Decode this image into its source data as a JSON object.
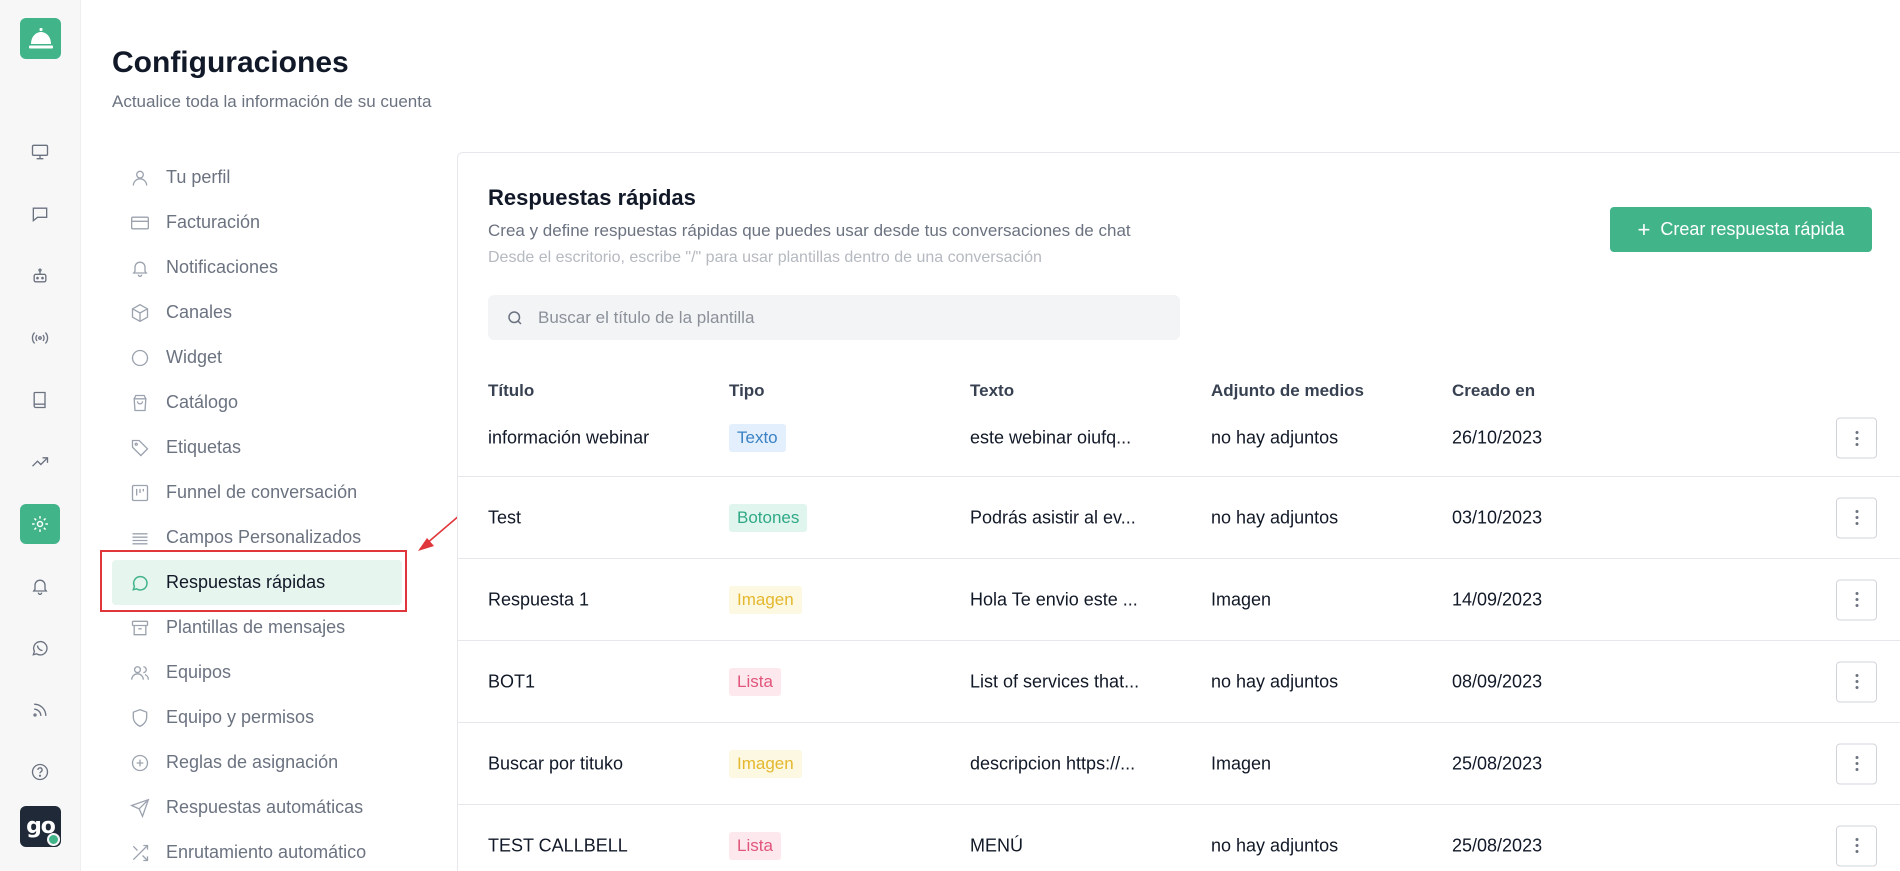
{
  "header": {
    "title": "Configuraciones",
    "subtitle": "Actualice toda la información de su cuenta"
  },
  "rail": {
    "items": [
      {
        "icon": "monitor-icon"
      },
      {
        "icon": "chat-icon"
      },
      {
        "icon": "bot-icon"
      },
      {
        "icon": "broadcast-icon"
      },
      {
        "icon": "book-icon"
      },
      {
        "icon": "trending-icon"
      },
      {
        "icon": "gear-icon",
        "active": true
      },
      {
        "icon": "bell-icon"
      },
      {
        "icon": "whatsapp-icon"
      },
      {
        "icon": "rss-icon"
      },
      {
        "icon": "help-icon"
      }
    ],
    "avatar_text": "go"
  },
  "settings_menu": {
    "items": [
      {
        "label": "Tu perfil",
        "icon": "user-icon"
      },
      {
        "label": "Facturación",
        "icon": "credit-card-icon"
      },
      {
        "label": "Notificaciones",
        "icon": "bell-icon"
      },
      {
        "label": "Canales",
        "icon": "cube-icon"
      },
      {
        "label": "Widget",
        "icon": "circle-icon"
      },
      {
        "label": "Catálogo",
        "icon": "shopping-bag-icon"
      },
      {
        "label": "Etiquetas",
        "icon": "tag-icon"
      },
      {
        "label": "Funnel de conversación",
        "icon": "kanban-icon"
      },
      {
        "label": "Campos Personalizados",
        "icon": "list-icon"
      },
      {
        "label": "Respuestas rápidas",
        "icon": "message-circle-icon",
        "active": true
      },
      {
        "label": "Plantillas de mensajes",
        "icon": "archive-icon"
      },
      {
        "label": "Equipos",
        "icon": "users-icon"
      },
      {
        "label": "Equipo y permisos",
        "icon": "shield-icon"
      },
      {
        "label": "Reglas de asignación",
        "icon": "plus-circle-icon"
      },
      {
        "label": "Respuestas automáticas",
        "icon": "send-icon"
      },
      {
        "label": "Enrutamiento automático",
        "icon": "shuffle-icon"
      }
    ]
  },
  "panel": {
    "title": "Respuestas rápidas",
    "description": "Crea y define respuestas rápidas que puedes usar desde tus conversaciones de chat",
    "hint": "Desde el escritorio, escribe \"/\" para usar plantillas dentro de una conversación",
    "create_button": "Crear respuesta rápida",
    "search_placeholder": "Buscar el título de la plantilla"
  },
  "table": {
    "columns": [
      "Título",
      "Tipo",
      "Texto",
      "Adjunto de medios",
      "Creado en"
    ],
    "rows": [
      {
        "title": "información webinar",
        "type": "Texto",
        "type_style": "texto",
        "text": "este webinar oiufq...",
        "media": "no hay adjuntos",
        "created": "26/10/2023"
      },
      {
        "title": "Test",
        "type": "Botones",
        "type_style": "botones",
        "text": "Podrás asistir al ev...",
        "media": "no hay adjuntos",
        "created": "03/10/2023"
      },
      {
        "title": "Respuesta 1",
        "type": "Imagen",
        "type_style": "imagen",
        "text": "Hola Te envio este ...",
        "media": "Imagen",
        "created": "14/09/2023"
      },
      {
        "title": "BOT1",
        "type": "Lista",
        "type_style": "lista",
        "text": "List of services that...",
        "media": "no hay adjuntos",
        "created": "08/09/2023"
      },
      {
        "title": "Buscar por tituko",
        "type": "Imagen",
        "type_style": "imagen",
        "text": "descripcion https://...",
        "media": "Imagen",
        "created": "25/08/2023"
      },
      {
        "title": "TEST CALLBELL",
        "type": "Lista",
        "type_style": "lista",
        "text": "MENÚ",
        "media": "no hay adjuntos",
        "created": "25/08/2023"
      }
    ]
  },
  "colors": {
    "accent": "#42b48a",
    "annotation": "#e0353b"
  }
}
